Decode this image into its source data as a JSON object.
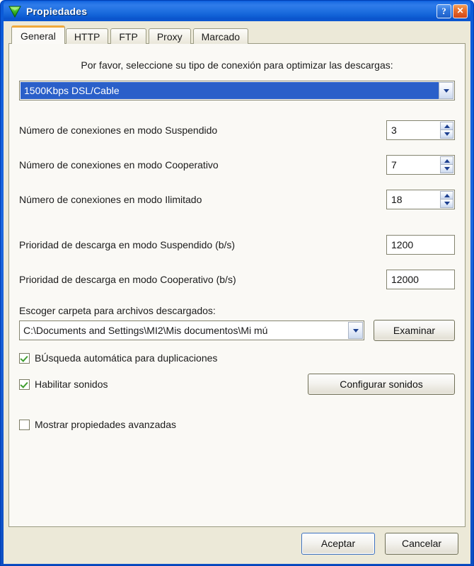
{
  "window": {
    "title": "Propiedades",
    "icon": "green-download-triangle-icon",
    "help_label": "?",
    "close_label": "✕",
    "accent_titlebar": "#1e6fe4",
    "accent_tab_active": "#f0a93a",
    "dialog_bg": "#ece9d8",
    "panel_bg": "#faf9f5",
    "selection_blue": "#2a5fc9",
    "check_green": "#3f9e2f"
  },
  "tabs": [
    {
      "label": "General",
      "active": true
    },
    {
      "label": "HTTP",
      "active": false
    },
    {
      "label": "FTP",
      "active": false
    },
    {
      "label": "Proxy",
      "active": false
    },
    {
      "label": "Marcado",
      "active": false
    }
  ],
  "general": {
    "hint": "Por favor, seleccione su tipo de conexión para optimizar las descargas:",
    "connection": {
      "value": "1500Kbps DSL/Cable",
      "selected": true
    },
    "connections": [
      {
        "label": "Número de conexiones en modo Suspendido",
        "value": "3"
      },
      {
        "label": "Número de conexiones en modo Cooperativo",
        "value": "7"
      },
      {
        "label": "Número de conexiones en modo Ilimitado",
        "value": "18"
      }
    ],
    "priorities": [
      {
        "label": "Prioridad de descarga en modo Suspendido (b/s)",
        "value": "1200"
      },
      {
        "label": "Prioridad de descarga en modo Cooperativo (b/s)",
        "value": "12000"
      }
    ],
    "folder": {
      "label": "Escoger carpeta para archivos descargados:",
      "path": "C:\\Documents and Settings\\MI2\\Mis documentos\\Mi mú",
      "browse_label": "Examinar"
    },
    "checkboxes": [
      {
        "label": "BÚsqueda automática para duplicaciones",
        "checked": true
      },
      {
        "label": "Habilitar sonidos",
        "checked": true
      },
      {
        "label": "Mostrar propiedades avanzadas",
        "checked": false
      }
    ],
    "sounds_button": "Configurar sonidos"
  },
  "footer": {
    "ok_label": "Aceptar",
    "cancel_label": "Cancelar"
  }
}
